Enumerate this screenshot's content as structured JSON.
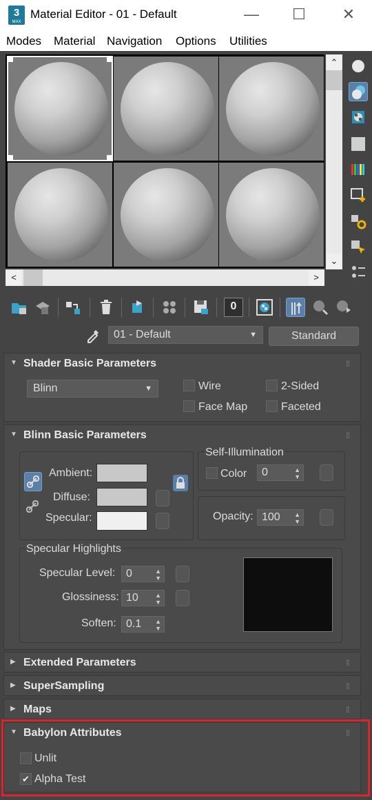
{
  "window": {
    "title": "Material Editor - 01 - Default",
    "app_icon_label": "3",
    "app_icon_sublabel": "MAX",
    "minimize_glyph": "—",
    "maximize_glyph": "☐",
    "close_glyph": "✕"
  },
  "menu": {
    "items": [
      "Modes",
      "Material",
      "Navigation",
      "Options",
      "Utilities"
    ]
  },
  "sample_slots": {
    "count": 6,
    "active_index": 0
  },
  "side_toolbar": {
    "icons": [
      "sphere-sample-type-icon",
      "backlight-icon",
      "background-checker-icon",
      "sample-uv-tiling-icon",
      "video-color-check-icon",
      "make-preview-icon",
      "options-icon",
      "select-by-material-icon",
      "material-map-navigator-icon"
    ]
  },
  "bottom_toolbar": {
    "icons": [
      "get-material-icon",
      "put-to-scene-icon",
      "assign-to-selection-icon",
      "delete-icon",
      "make-unique-icon",
      "put-to-library-icon",
      "material-id-channel-icon",
      "show-shaded-material-icon",
      "show-end-result-icon",
      "go-to-parent-icon",
      "go-forward-icon"
    ],
    "material_id_value": "0"
  },
  "material_row": {
    "material_name": "01 - Default",
    "material_type": "Standard"
  },
  "shader_basic": {
    "title": "Shader Basic Parameters",
    "shader": "Blinn",
    "wire_label": "Wire",
    "two_sided_label": "2-Sided",
    "face_map_label": "Face Map",
    "faceted_label": "Faceted"
  },
  "blinn_basic": {
    "title": "Blinn Basic Parameters",
    "ambient_label": "Ambient:",
    "diffuse_label": "Diffuse:",
    "specular_label": "Specular:",
    "ambient_color": "#c8c8c8",
    "diffuse_color": "#c8c8c8",
    "specular_color": "#f0f0f0",
    "self_illum_title": "Self-Illumination",
    "color_label": "Color",
    "self_illum_value": "0",
    "opacity_label": "Opacity:",
    "opacity_value": "100",
    "spec_highlights_title": "Specular Highlights",
    "spec_level_label": "Specular Level:",
    "spec_level_value": "0",
    "glossiness_label": "Glossiness:",
    "glossiness_value": "10",
    "soften_label": "Soften:",
    "soften_value": "0.1",
    "highlight_curve_color": "#0d0d0d"
  },
  "rollouts": {
    "extended": "Extended Parameters",
    "supersampling": "SuperSampling",
    "maps": "Maps"
  },
  "babylon": {
    "title": "Babylon Attributes",
    "unlit_label": "Unlit",
    "unlit_checked": false,
    "alpha_test_label": "Alpha Test",
    "alpha_test_checked": true,
    "highlight_color": "#e0232b"
  },
  "glyphs": {
    "expanded": "▼",
    "collapsed": "▶",
    "dropdown": "▼",
    "spin_up": "▲",
    "spin_down": "▼",
    "scroll_up": "⌃",
    "scroll_down": "⌄",
    "scroll_left": "<",
    "scroll_right": ">",
    "grip": "⁞⁞",
    "check": "✔"
  }
}
